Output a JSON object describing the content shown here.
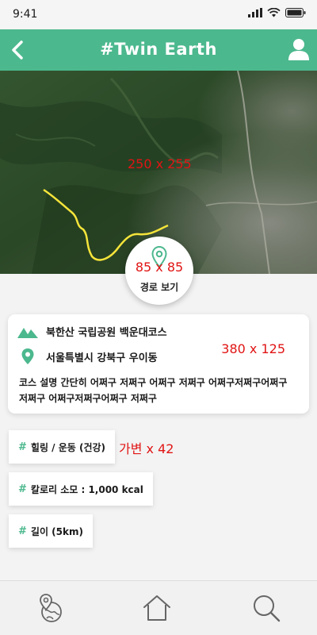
{
  "status_bar": {
    "time": "9:41"
  },
  "header": {
    "title": "#Twin Earth"
  },
  "map": {
    "size_label": "250 x 255"
  },
  "route_button": {
    "size_label": "85 x 85",
    "label": "경로 보기"
  },
  "info_card": {
    "course_name": "북한산 국립공원 백운대코스",
    "address": "서울특별시 강북구 우이동",
    "description": "코스 설명 간단히 어쩌구 저쩌구 어쩌구 저쩌구 어쩌구저쩌구어쩌구 저쩌구 어쩌구저쩌구어쩌구 저쩌구",
    "size_label": "380 x 125"
  },
  "tags": [
    {
      "hash": "#",
      "text": "힐링 / 운동 (건강)"
    },
    {
      "hash": "#",
      "text": "칼로리 소모 : 1,000 kcal"
    },
    {
      "hash": "#",
      "text": "길이 (5km)"
    }
  ],
  "tag_size_label": "가변 x 42",
  "colors": {
    "brand": "#4cb88e",
    "annotation": "#e11414",
    "trail": "#f5e43a"
  },
  "icons": {
    "back": "chevron-left-icon",
    "profile": "user-icon",
    "route": "map-pin-icon",
    "mountain": "mountain-icon",
    "location": "map-pin-icon",
    "nav_map": "globe-pin-icon",
    "nav_home": "home-icon",
    "nav_search": "search-icon"
  }
}
